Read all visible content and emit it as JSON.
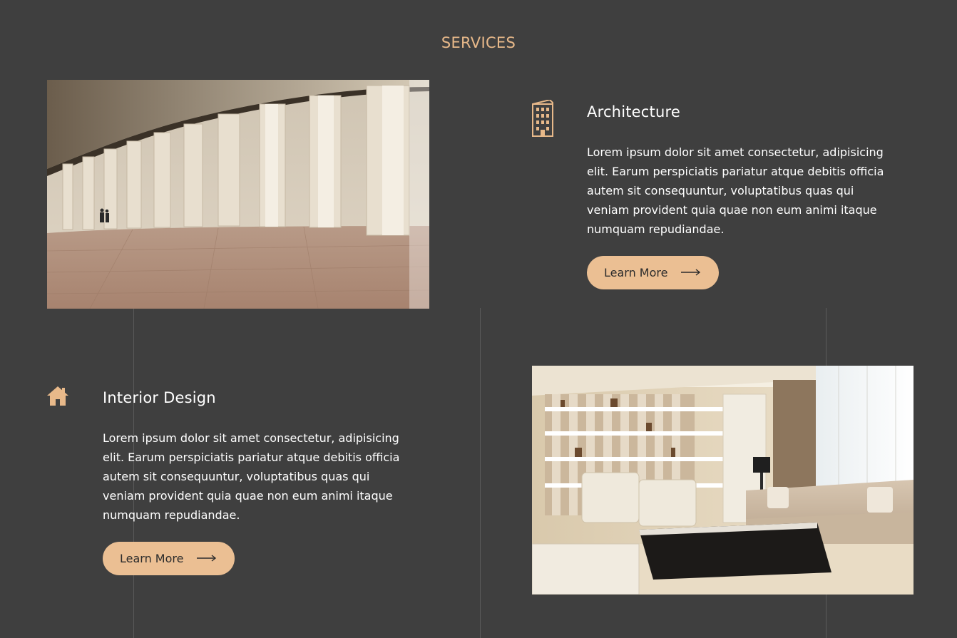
{
  "section": {
    "title": "SERVICES"
  },
  "services": [
    {
      "icon": "building-icon",
      "heading": "Architecture",
      "text": "Lorem ipsum dolor sit amet consectetur, adipisicing elit. Earum perspiciatis pariatur atque debitis officia autem sit consequuntur, voluptatibus quas qui veniam provident quia quae non eum animi itaque numquam repudiandae.",
      "button_label": "Learn More"
    },
    {
      "icon": "home-icon",
      "heading": "Interior Design",
      "text": "Lorem ipsum dolor sit amet consectetur, adipisicing elit. Earum perspiciatis pariatur atque debitis officia autem sit consequuntur, voluptatibus quas qui veniam provident quia quae non eum animi itaque numquam repudiandae.",
      "button_label": "Learn More"
    }
  ],
  "colors": {
    "background": "#3f3f3f",
    "accent": "#e8b98a",
    "button": "#ebbf93",
    "divider": "#5a5a5a"
  }
}
